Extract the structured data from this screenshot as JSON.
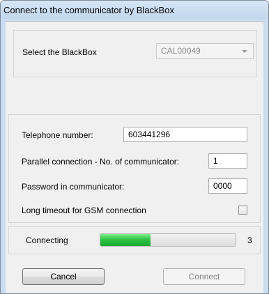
{
  "window": {
    "title": "Connect to the communicator by BlackBox"
  },
  "blackbox": {
    "label": "Select the BlackBox",
    "selected": "CAL00049"
  },
  "form": {
    "telephone_label": "Telephone number:",
    "telephone_value": "603441296",
    "parallel_label": "Parallel connection - No. of communicator:",
    "parallel_value": "1",
    "password_label": "Password in communicator:",
    "password_value": "0000",
    "timeout_label": "Long timeout for GSM connection",
    "timeout_checked": false
  },
  "status": {
    "label": "Connecting",
    "progress": 0.37,
    "count": "3"
  },
  "buttons": {
    "cancel": "Cancel",
    "connect": "Connect"
  }
}
